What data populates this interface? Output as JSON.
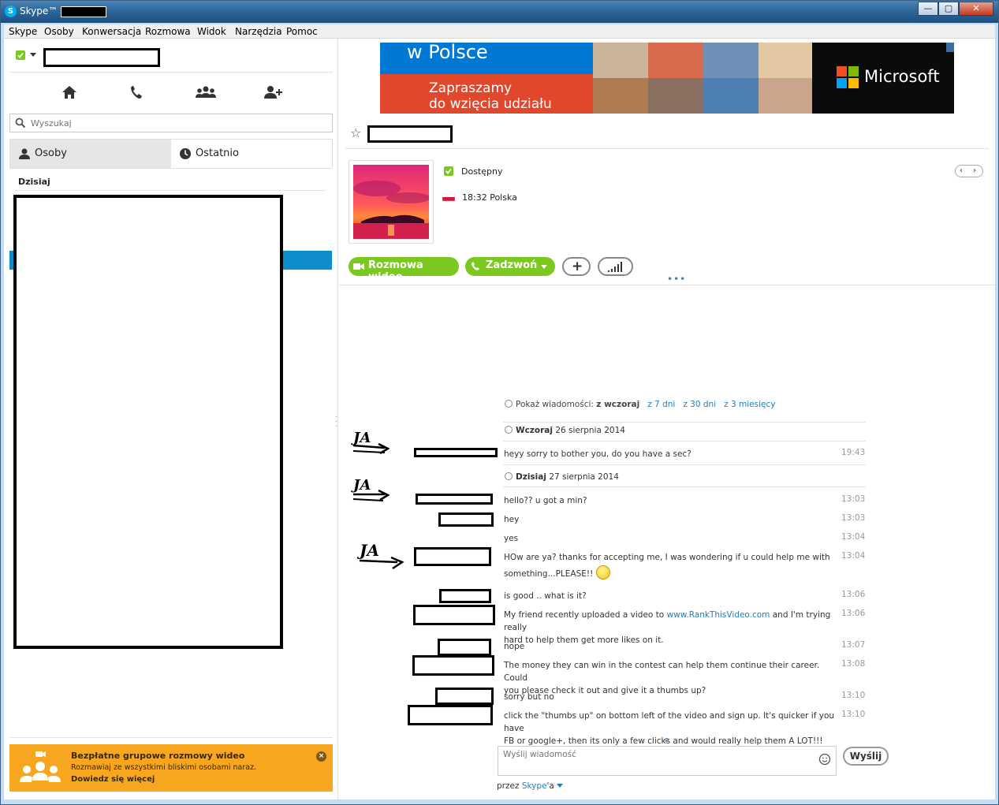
{
  "window": {
    "title": "Skype™ - ",
    "logo": "S",
    "buttons": [
      "—",
      "▢",
      "✕"
    ]
  },
  "menu": [
    "Skype",
    "Osoby",
    "Konwersacja",
    "Rozmowa",
    "Widok",
    "Narzędzia",
    "Pomoc"
  ],
  "left": {
    "search_placeholder": "Wyszukaj",
    "tabs": [
      "Osoby",
      "Ostatnio"
    ],
    "section_today": "Dzisiaj",
    "promo": {
      "title": "Bezpłatne grupowe rozmowy wideo",
      "text": "Rozmawiaj ze wszystkimi bliskimi osobami naraz.",
      "link": "Dowiedz się więcej"
    },
    "status_color": "#7bc820"
  },
  "ad": {
    "headline": "w Polsce",
    "subline": "Zapraszamy\ndo wzięcia udziału",
    "brand": "Microsoft"
  },
  "contact": {
    "presence": "Dostępny",
    "time_location": "18:32 Polska",
    "buttons": {
      "video": "Rozmowa wideo",
      "call": "Zadzwoń",
      "add": "+"
    }
  },
  "chat": {
    "show_prefix": "Pokaż wiadomości:",
    "show_options": [
      "z wczoraj",
      "z 7 dni",
      "z 30 dni",
      "z 3 miesięcy"
    ],
    "days": [
      {
        "label": "Wczoraj",
        "date": "26 sierpnia 2014"
      },
      {
        "label": "Dzisiaj",
        "date": "27 sierpnia 2014"
      }
    ],
    "messages": [
      {
        "text": "heyy sorry to bother you, do you have a sec?",
        "time": "19:43"
      },
      {
        "text": "hello?? u got a min?",
        "time": "13:03"
      },
      {
        "text": "hey",
        "time": "13:03"
      },
      {
        "text": "yes",
        "time": "13:04"
      },
      {
        "text": "HOw are ya? thanks for accepting me, I was wondering if u could help me with",
        "text2": "something...PLEASE!!",
        "time": "13:04"
      },
      {
        "text": "is good .. what is it?",
        "time": "13:06"
      },
      {
        "text_pre": "My friend recently uploaded a video to ",
        "link": "www.RankThisVideo.com",
        "text_post": " and I'm trying really",
        "text2": "hard to help them get more likes on it.",
        "time": "13:06"
      },
      {
        "text": "nope",
        "time": "13:07"
      },
      {
        "text": "The money they can win in the contest can help them continue their career.  Could",
        "text2": "you please check it out and give it a thumbs up?",
        "time": "13:08"
      },
      {
        "text": "sorry but no",
        "time": "13:10"
      },
      {
        "text": "click the \"thumbs up\" on bottom left of the video and sign up. It's quicker if you have",
        "text2": "FB or google+, then its only a few clicks and would really help them A LOT!!!",
        "time": "13:10"
      }
    ],
    "input_placeholder": "Wyślij wiadomość",
    "send_label": "Wyślij",
    "via_prefix": "przez ",
    "via_link": "Skype",
    "via_suffix": "'a",
    "handwriting": [
      "JA",
      "JA",
      "JA"
    ]
  }
}
